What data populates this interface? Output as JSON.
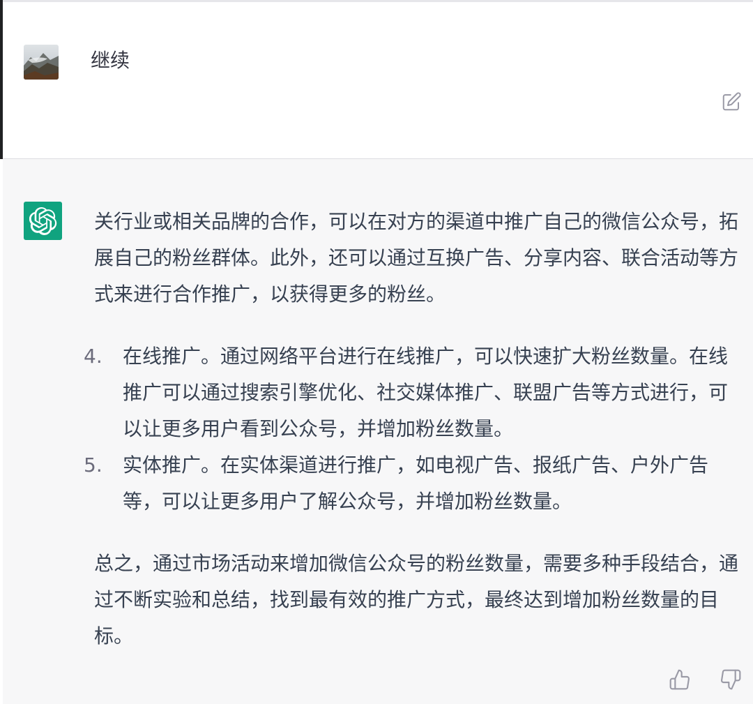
{
  "user_message": {
    "avatar_icon": "user-avatar-landscape",
    "text": "继续",
    "edit_icon": "edit-icon"
  },
  "assistant_message": {
    "avatar_icon": "openai-logo-icon",
    "avatar_color": "#10a37f",
    "intro_paragraph": "关行业或相关品牌的合作，可以在对方的渠道中推广自己的微信公众号，拓展自己的粉丝群体。此外，还可以通过互换广告、分享内容、联合活动等方式来进行合作推广，以获得更多的粉丝。",
    "list_items": [
      {
        "number": "4.",
        "text": "在线推广。通过网络平台进行在线推广，可以快速扩大粉丝数量。在线推广可以通过搜索引擎优化、社交媒体推广、联盟广告等方式进行，可以让更多用户看到公众号，并增加粉丝数量。"
      },
      {
        "number": "5.",
        "text": "实体推广。在实体渠道进行推广，如电视广告、报纸广告、户外广告等，可以让更多用户了解公众号，并增加粉丝数量。"
      }
    ],
    "conclusion_paragraph": "总之，通过市场活动来增加微信公众号的粉丝数量，需要多种手段结合，通过不断实验和总结，找到最有效的推广方式，最终达到增加粉丝数量的目标。",
    "feedback": {
      "like_icon": "thumbs-up-icon",
      "dislike_icon": "thumbs-down-icon"
    }
  }
}
